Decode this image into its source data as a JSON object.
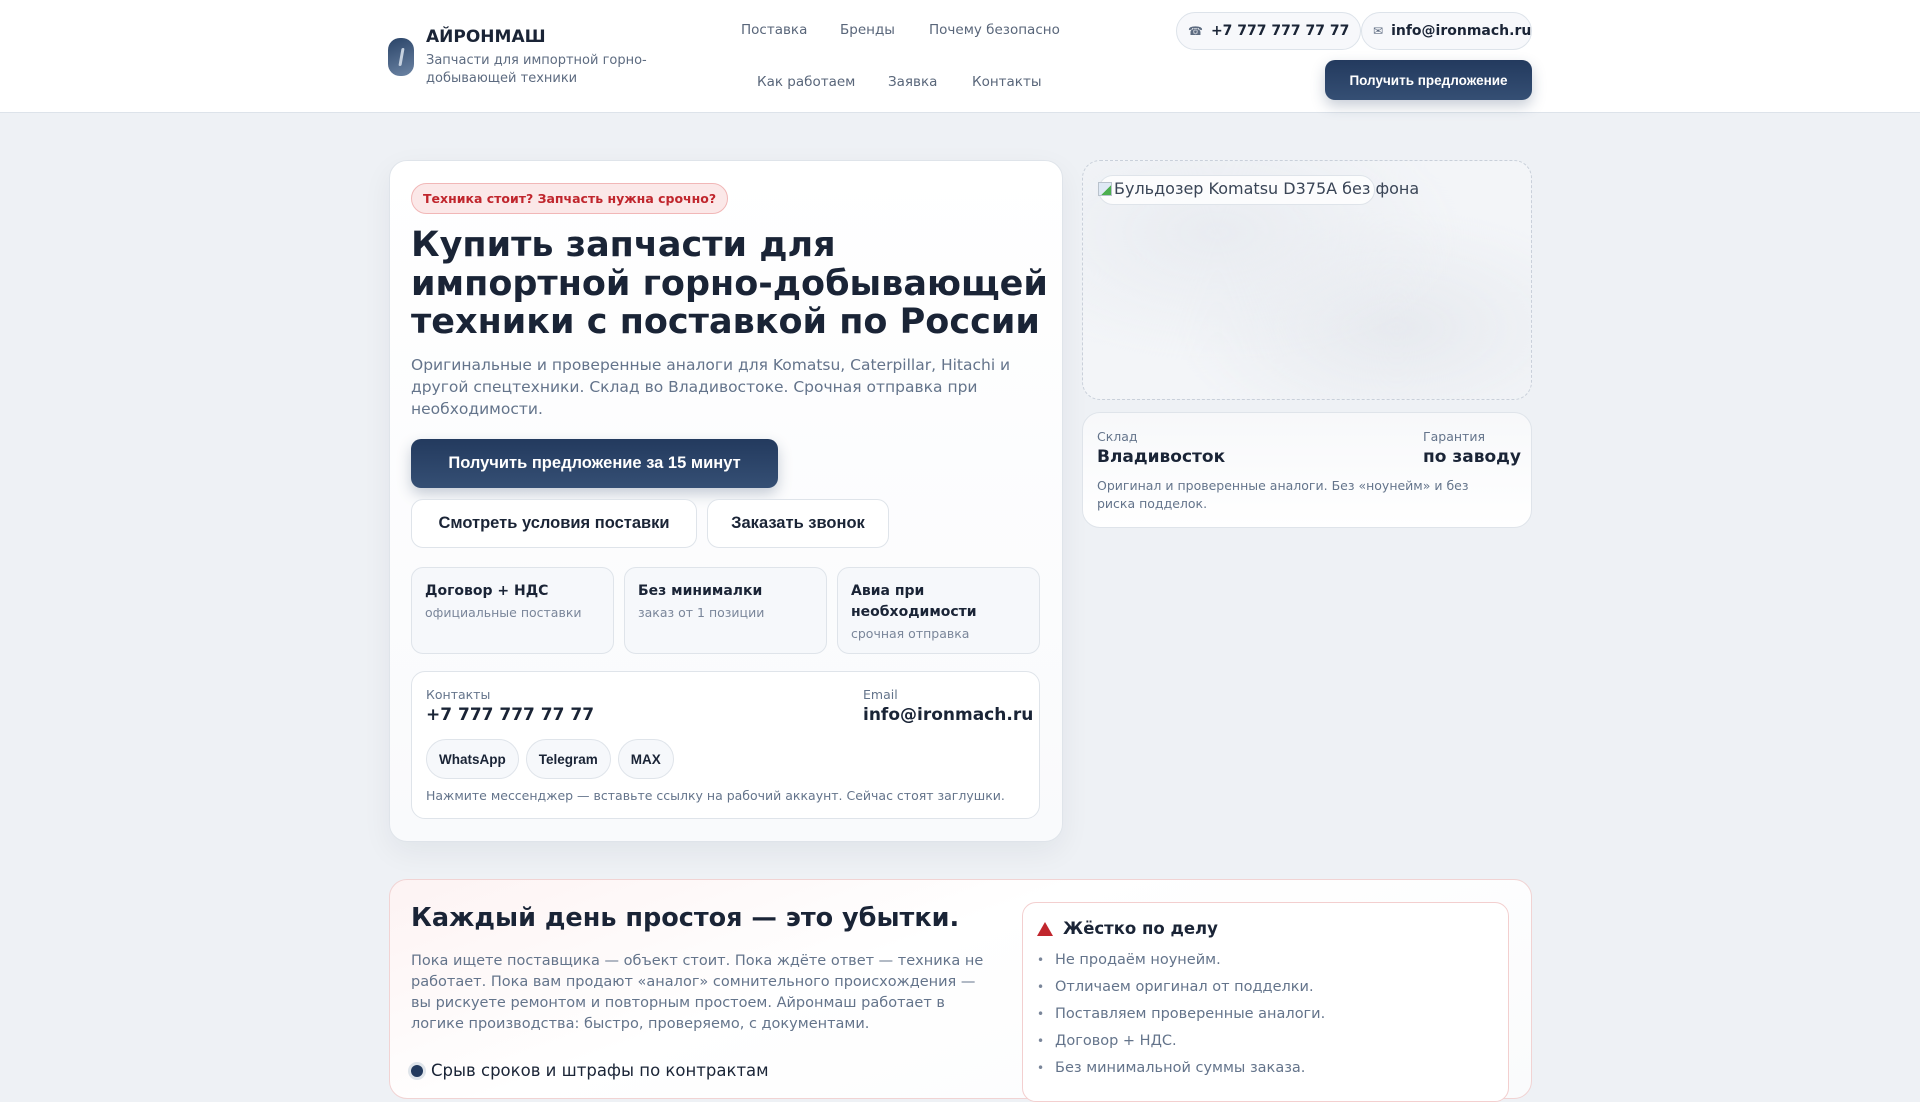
{
  "header": {
    "brand": "АЙРОНМАШ",
    "tagline": "Запчасти для импортной горно-добывающей техники",
    "nav": [
      "Поставка",
      "Бренды",
      "Почему безопасно",
      "Как работаем",
      "Заявка",
      "Контакты"
    ],
    "phone": "+7 777 777 77 77",
    "email": "info@ironmach.ru",
    "cta": "Получить предложение",
    "icons": {
      "phone": "☎",
      "email": "✉"
    }
  },
  "hero": {
    "badge": "Техника стоит? Запчасть нужна срочно?",
    "title": "Купить запчасти для импортной горно-добывающей техники с поставкой по России",
    "lead": "Оригинальные и проверенные аналоги для Komatsu, Caterpillar, Hitachi и другой спецтехники. Склад во Владивостоке. Срочная отправка при необходимости.",
    "primary_cta": "Получить предложение за 15 минут",
    "secondary_ctas": [
      "Смотреть условия поставки",
      "Заказать звонок"
    ],
    "features": [
      {
        "title": "Договор + НДС",
        "sub": "официальные поставки"
      },
      {
        "title": "Без минималки",
        "sub": "заказ от 1 позиции"
      },
      {
        "title": "Авиа при необходимости",
        "sub": "срочная отправка"
      }
    ],
    "contacts": {
      "label": "Контакты",
      "phone": "+7 777 777 77 77",
      "email_label": "Email",
      "email": "info@ironmach.ru",
      "messengers": [
        "WhatsApp",
        "Telegram",
        "MAX"
      ],
      "note": "Нажмите мессенджер — вставьте ссылку на рабочий аккаунт. Сейчас стоят заглушки."
    }
  },
  "aside": {
    "image_alt": "Бульдозер Komatsu D375A без фона",
    "stock_label": "Склад",
    "stock_value": "Владивосток",
    "warranty_label": "Гарантия",
    "warranty_value": "по заводу",
    "note": "Оригинал и проверенные аналоги. Без «ноунейм» и без риска подделок."
  },
  "downtime": {
    "title": "Каждый день простоя — это убытки.",
    "text": "Пока ищете поставщика — объект стоит. Пока ждёте ответ — техника не работает. Пока вам продают «аналог» сомнительного происхождения — вы рискуете ремонтом и повторным простоем. Айронмаш работает в логике производства: быстро, проверяемо, с документами.",
    "risks": [
      "Срыв сроков и штрафы по контрактам"
    ],
    "hard_title": "Жёстко по делу",
    "hard_items": [
      "Не продаём ноунейм.",
      "Отличаем оригинал от подделки.",
      "Поставляем проверенные аналоги.",
      "Договор + НДС.",
      "Без минимальной суммы заказа."
    ],
    "accent": "#c0262d"
  }
}
